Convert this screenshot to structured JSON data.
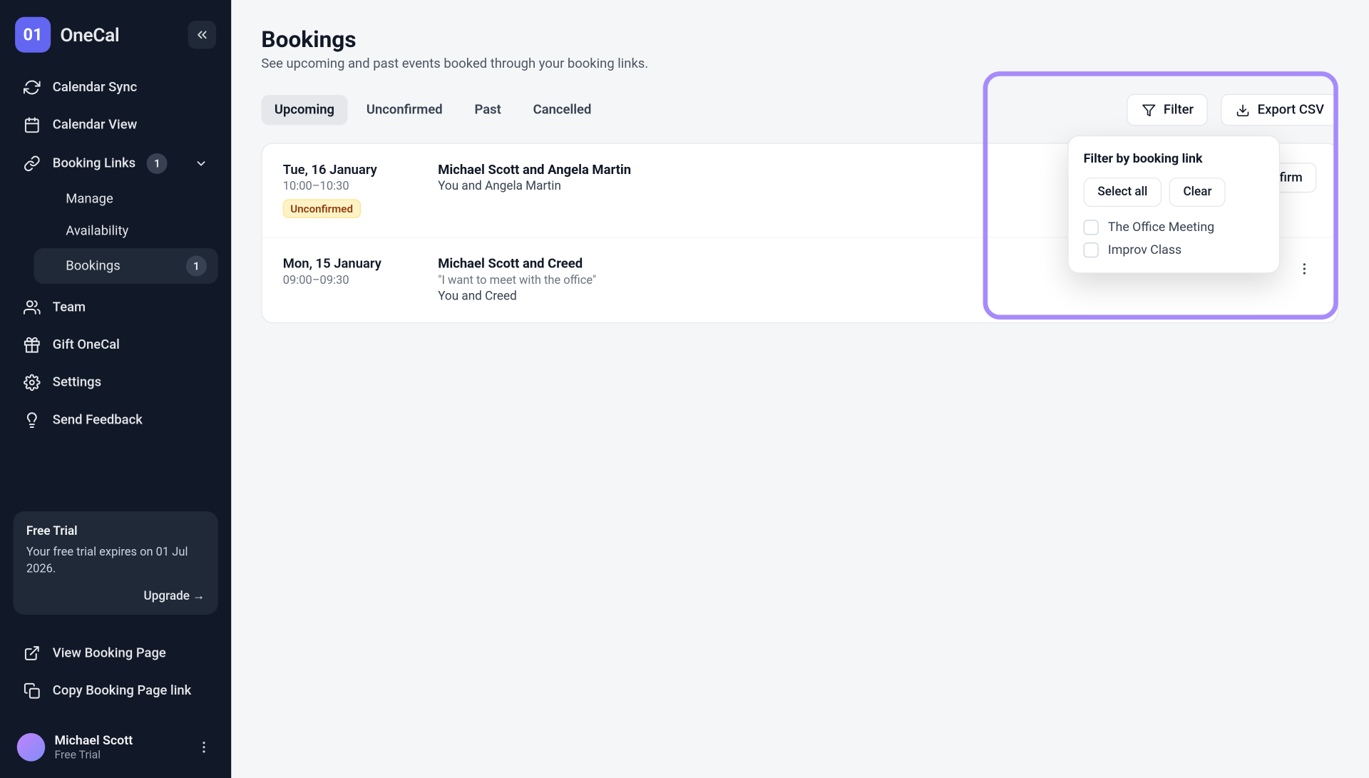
{
  "brand": {
    "mark": "01",
    "name": "OneCal"
  },
  "sidebar": {
    "items": [
      {
        "label": "Calendar Sync"
      },
      {
        "label": "Calendar View"
      },
      {
        "label": "Booking Links",
        "badge": "1"
      },
      {
        "label": "Team"
      },
      {
        "label": "Gift OneCal"
      },
      {
        "label": "Settings"
      },
      {
        "label": "Send Feedback"
      }
    ],
    "booking_subnav": [
      {
        "label": "Manage"
      },
      {
        "label": "Availability"
      },
      {
        "label": "Bookings",
        "badge": "1"
      }
    ],
    "bottom_links": [
      {
        "label": "View Booking Page"
      },
      {
        "label": "Copy Booking Page link"
      }
    ]
  },
  "trial": {
    "title": "Free Trial",
    "body": "Your free trial expires on 01 Jul 2026.",
    "upgrade": "Upgrade →"
  },
  "user": {
    "name": "Michael Scott",
    "plan": "Free Trial"
  },
  "page": {
    "title": "Bookings",
    "subtitle": "See upcoming and past events booked through your booking links."
  },
  "tabs": {
    "items": [
      "Upcoming",
      "Unconfirmed",
      "Past",
      "Cancelled"
    ],
    "active": 0
  },
  "actions": {
    "filter": "Filter",
    "export": "Export CSV",
    "confirm": "Confirm"
  },
  "filter_popover": {
    "heading": "Filter by booking link",
    "select_all": "Select all",
    "clear": "Clear",
    "options": [
      "The Office Meeting",
      "Improv Class"
    ]
  },
  "bookings": [
    {
      "date": "Tue, 16 January",
      "time": "10:00–10:30",
      "status": "Unconfirmed",
      "title": "Michael Scott and Angela Martin",
      "note": "",
      "who": "You and Angela Martin",
      "show_confirm": true
    },
    {
      "date": "Mon, 15 January",
      "time": "09:00–09:30",
      "status": "",
      "title": "Michael Scott and Creed",
      "note": "\"I want to meet with the office\"",
      "who": "You and Creed",
      "show_confirm": false
    }
  ]
}
